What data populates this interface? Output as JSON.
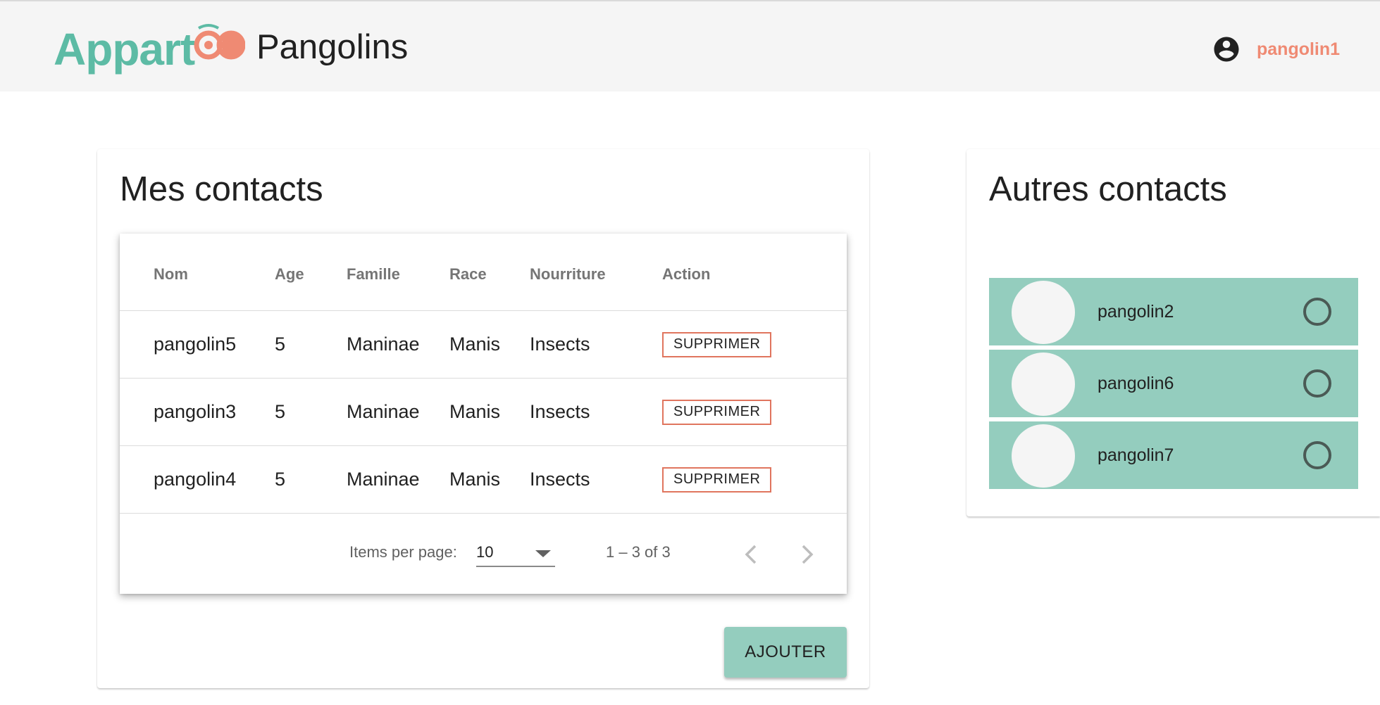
{
  "header": {
    "logo_text": "Appart",
    "app_name": "Pangolins",
    "user_icon": "account-circle-icon",
    "username": "pangolin1",
    "colors": {
      "logo": "#5dbba5",
      "logo_accent": "#ef8a73",
      "username": "#ef8a73",
      "bar_bg": "#f5f5f5"
    }
  },
  "my_contacts": {
    "title": "Mes contacts",
    "table": {
      "columns": [
        "Nom",
        "Age",
        "Famille",
        "Race",
        "Nourriture",
        "Action"
      ],
      "rows": [
        {
          "nom": "pangolin5",
          "age": "5",
          "famille": "Maninae",
          "race": "Manis",
          "nourriture": "Insects",
          "action": "SUPPRIMER"
        },
        {
          "nom": "pangolin3",
          "age": "5",
          "famille": "Maninae",
          "race": "Manis",
          "nourriture": "Insects",
          "action": "SUPPRIMER"
        },
        {
          "nom": "pangolin4",
          "age": "5",
          "famille": "Maninae",
          "race": "Manis",
          "nourriture": "Insects",
          "action": "SUPPRIMER"
        }
      ]
    },
    "paginator": {
      "items_per_page_label": "Items per page:",
      "items_per_page_value": "10",
      "range_label": "1 – 3 of 3",
      "prev_icon": "chevron-left-icon",
      "next_icon": "chevron-right-icon"
    },
    "add_button": "AJOUTER",
    "colors": {
      "delete_border": "#e0755e",
      "add_button_bg": "#94cdbe"
    }
  },
  "other_contacts": {
    "title": "Autres contacts",
    "items": [
      {
        "name": "pangolin2",
        "selected": false
      },
      {
        "name": "pangolin6",
        "selected": false
      },
      {
        "name": "pangolin7",
        "selected": false
      }
    ],
    "colors": {
      "item_bg": "#94cdbe",
      "avatar_bg": "#f5f5f5"
    }
  }
}
